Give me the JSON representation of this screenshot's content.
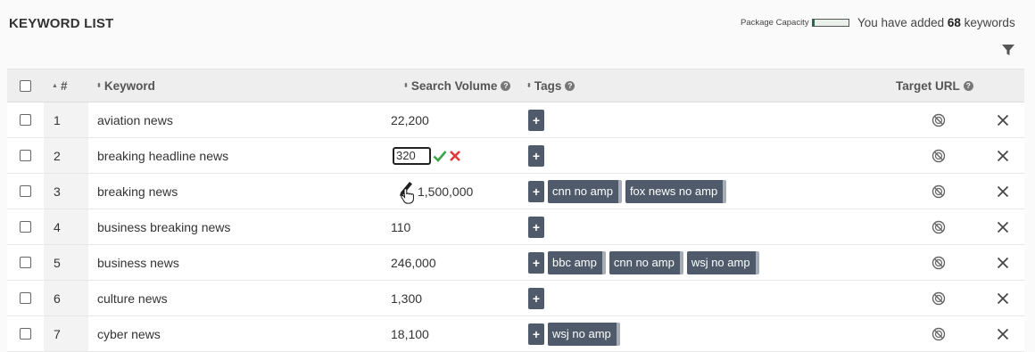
{
  "header": {
    "title": "KEYWORD LIST",
    "capacity_label": "Package Capacity",
    "capacity_fill": 0.07,
    "added_prefix": "You have added",
    "added_count": "68",
    "added_suffix": "keywords"
  },
  "columns": {
    "num": "#",
    "keyword": "Keyword",
    "volume": "Search Volume",
    "tags": "Tags",
    "url": "Target URL"
  },
  "tag_add": "+",
  "edit": {
    "input_value": "320"
  },
  "rows": [
    {
      "num": "1",
      "keyword": "aviation news",
      "volume": "22,200",
      "tags": []
    },
    {
      "num": "2",
      "keyword": "breaking headline news",
      "volume": "",
      "tags": []
    },
    {
      "num": "3",
      "keyword": "breaking news",
      "volume": "1,500,000",
      "tags": [
        "cnn no amp",
        "fox news no amp"
      ]
    },
    {
      "num": "4",
      "keyword": "business breaking news",
      "volume": "110",
      "tags": []
    },
    {
      "num": "5",
      "keyword": "business news",
      "volume": "246,000",
      "tags": [
        "bbc amp",
        "cnn no amp",
        "wsj no amp"
      ]
    },
    {
      "num": "6",
      "keyword": "culture news",
      "volume": "1,300",
      "tags": []
    },
    {
      "num": "7",
      "keyword": "cyber news",
      "volume": "18,100",
      "tags": [
        "wsj no amp"
      ]
    }
  ],
  "colors": {
    "tag_bg": "#4f5a6b",
    "ok": "#3aa547",
    "cancel": "#e23a3a"
  }
}
